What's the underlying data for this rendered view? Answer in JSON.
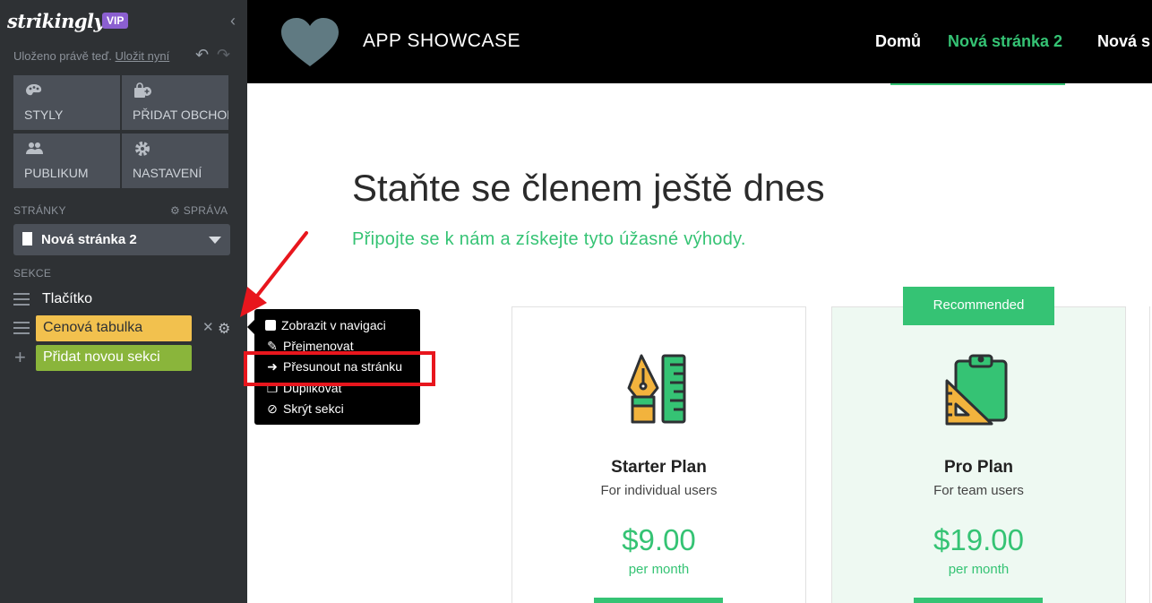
{
  "sidebar": {
    "brand": "strikingly",
    "vip": "VIP",
    "collapse": "‹",
    "saved_text": "Uloženo právě teď.",
    "save_link": "Uložit nyní",
    "tiles": [
      {
        "label": "STYLY",
        "icon": "palette-icon"
      },
      {
        "label": "PŘIDAT OBCHOD",
        "icon": "store-add-icon"
      },
      {
        "label": "PUBLIKUM",
        "icon": "people-icon"
      },
      {
        "label": "NASTAVENÍ",
        "icon": "gear-icon"
      }
    ],
    "pages_label": "STRÁNKY",
    "manage_label": "⚙ SPRÁVA",
    "current_page": "Nová stránka 2",
    "sections_label": "SEKCE",
    "sections": [
      "Tlačítko",
      "Cenová tabulka"
    ],
    "add_section": "Přidat novou sekci"
  },
  "header": {
    "title": "APP SHOWCASE",
    "nav": [
      "Domů",
      "Nová stránka 2",
      "Nová s"
    ]
  },
  "content": {
    "heading": "Staňte se členem ještě dnes",
    "subheading": "Připojte se k nám a získejte tyto úžasné výhody.",
    "recommended": "Recommended",
    "plans": [
      {
        "name": "Starter Plan",
        "desc": "For individual users",
        "price": "$9.00",
        "period": "per month"
      },
      {
        "name": "Pro Plan",
        "desc": "For team users",
        "price": "$19.00",
        "period": "per month"
      }
    ]
  },
  "context_menu": {
    "items": [
      "Zobrazit v navigaci",
      "Přejmenovat",
      "Přesunout na stránku",
      "Duplikovat",
      "Skrýt sekci"
    ]
  },
  "colors": {
    "accent_green": "#35c374",
    "sidebar_bg": "#2e3134",
    "highlight_red": "#e8161d",
    "section_yellow": "#f2c14e",
    "section_green": "#8ab53b"
  }
}
